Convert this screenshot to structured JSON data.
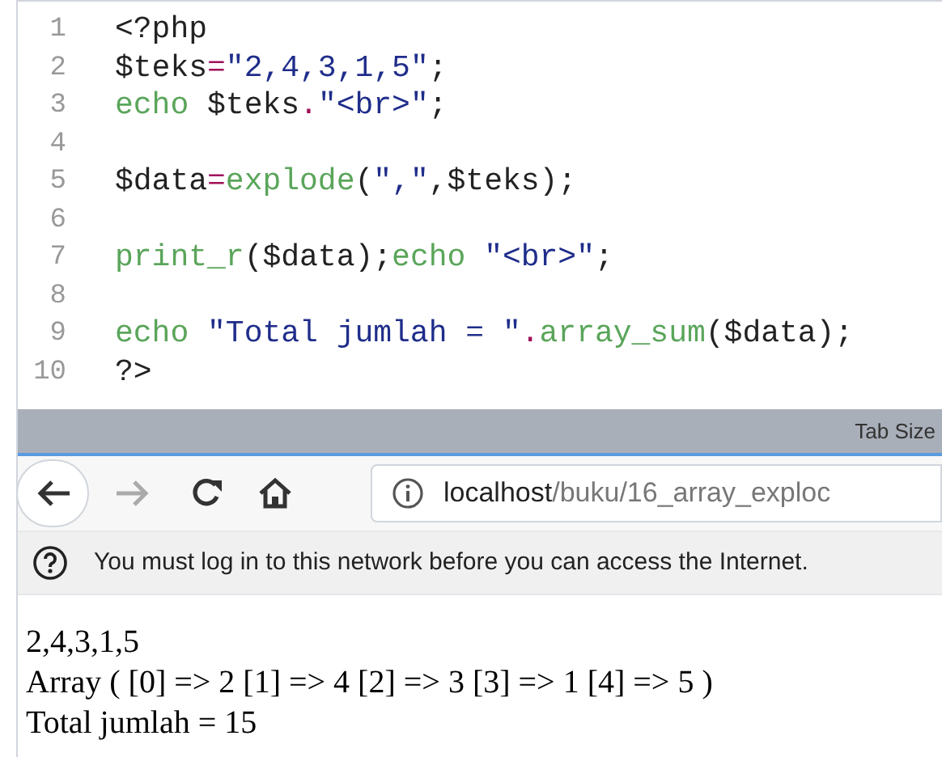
{
  "editor": {
    "lines": [
      {
        "number": "1",
        "tokens": [
          {
            "t": "<?php",
            "kind": "plain"
          }
        ]
      },
      {
        "number": "2",
        "tokens": [
          {
            "t": "$teks",
            "kind": "plain"
          },
          {
            "t": "=",
            "kind": "op"
          },
          {
            "t": "\"2,4,3,1,5\"",
            "kind": "string"
          },
          {
            "t": ";",
            "kind": "plain"
          }
        ]
      },
      {
        "number": "3",
        "tokens": [
          {
            "t": "echo",
            "kind": "keyword"
          },
          {
            "t": " $teks",
            "kind": "plain"
          },
          {
            "t": ".",
            "kind": "op"
          },
          {
            "t": "\"<br>\"",
            "kind": "string"
          },
          {
            "t": ";",
            "kind": "plain"
          }
        ]
      },
      {
        "number": "4"
      },
      {
        "number": "5",
        "tokens": [
          {
            "t": "$data",
            "kind": "plain"
          },
          {
            "t": "=",
            "kind": "op"
          },
          {
            "t": "explode",
            "kind": "keyword"
          },
          {
            "t": "(",
            "kind": "plain"
          },
          {
            "t": "\",\"",
            "kind": "string"
          },
          {
            "t": ",$teks);",
            "kind": "plain"
          }
        ]
      },
      {
        "number": "6"
      },
      {
        "number": "7",
        "tokens": [
          {
            "t": "print_r",
            "kind": "keyword"
          },
          {
            "t": "($data);",
            "kind": "plain"
          },
          {
            "t": "echo ",
            "kind": "keyword"
          },
          {
            "t": "\"<br>\"",
            "kind": "string"
          },
          {
            "t": ";",
            "kind": "plain"
          }
        ]
      },
      {
        "number": "8"
      },
      {
        "number": "9",
        "tokens": [
          {
            "t": "echo ",
            "kind": "keyword"
          },
          {
            "t": "\"Total jumlah = \"",
            "kind": "string"
          },
          {
            "t": ".",
            "kind": "op"
          },
          {
            "t": "array_sum",
            "kind": "keyword"
          },
          {
            "t": "($data);",
            "kind": "plain"
          }
        ]
      },
      {
        "number": "10",
        "tokens": [
          {
            "t": "?>",
            "kind": "plain"
          }
        ]
      }
    ]
  },
  "status_bar": {
    "tab_size": "Tab Size"
  },
  "browser": {
    "url_host": "localhost",
    "url_path": "/buku/16_array_exploc",
    "notice": "You must log in to this network before you can access the Internet."
  },
  "output": [
    "2,4,3,1,5",
    "Array ( [0] => 2 [1] => 4 [2] => 3 [3] => 1 [4] => 5 )",
    "Total jumlah = 15"
  ]
}
